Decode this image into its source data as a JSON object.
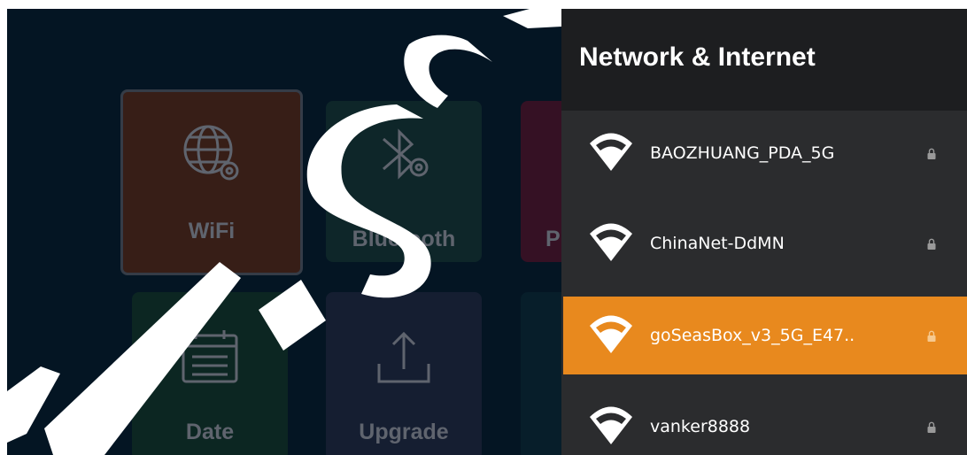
{
  "background_tiles": [
    {
      "label": "WiFi",
      "icon": "globe-gear-icon"
    },
    {
      "label": "Bluetooth",
      "icon": "bluetooth-gear-icon"
    },
    {
      "label": "P",
      "icon": ""
    },
    {
      "label": "Date",
      "icon": "calendar-icon"
    },
    {
      "label": "Upgrade",
      "icon": "upload-icon"
    }
  ],
  "panel": {
    "title": "Network & Internet",
    "networks": [
      {
        "ssid": "BAOZHUANG_PDA_5G",
        "secured": true,
        "selected": false
      },
      {
        "ssid": "ChinaNet-DdMN",
        "secured": true,
        "selected": false
      },
      {
        "ssid": "goSeasBox_v3_5G_E47..",
        "secured": true,
        "selected": true
      },
      {
        "ssid": "vanker8888",
        "secured": true,
        "selected": false
      }
    ]
  },
  "colors": {
    "accent": "#e8891e",
    "panel_bg": "#2b2c2e",
    "header_bg": "#1d1e20"
  }
}
